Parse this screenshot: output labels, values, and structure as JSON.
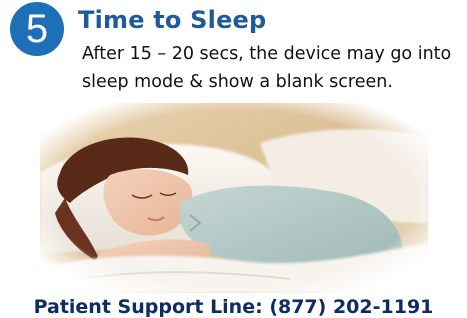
{
  "step": {
    "number": "5",
    "title": "Time to Sleep",
    "description": "After 15 – 20 secs, the device may go into sleep mode & show a blank screen."
  },
  "image": {
    "subject": "photo-woman-sleeping"
  },
  "support": {
    "text": "Patient Support Line: (877) 202-1191"
  },
  "colors": {
    "badge": "#1d6fb8",
    "title": "#1d5b9a",
    "support": "#0d2c66"
  }
}
